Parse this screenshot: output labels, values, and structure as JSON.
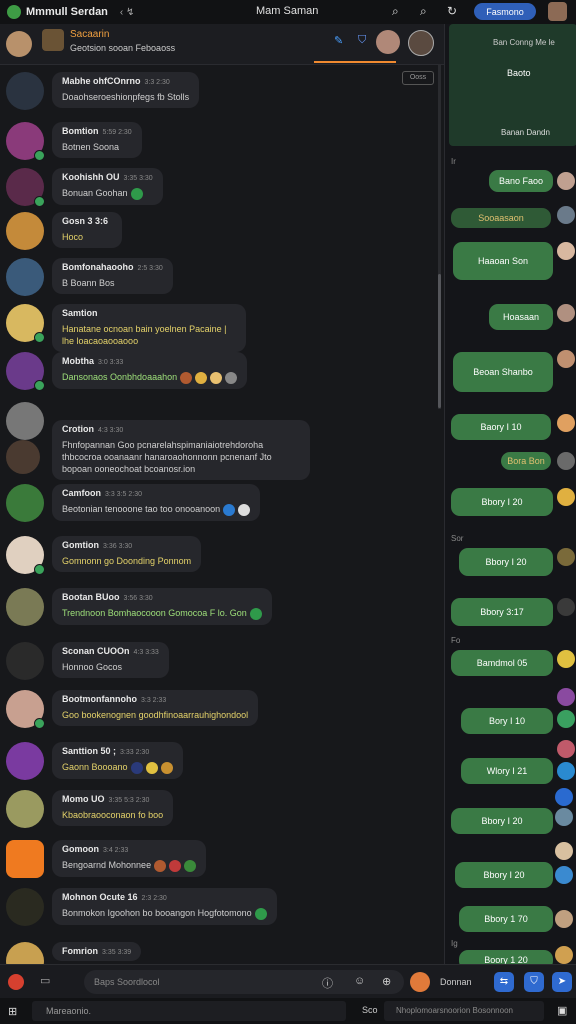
{
  "topbar": {
    "app_title": "Mmmull Serdan",
    "arrows": "‹ ↯",
    "center_title": "Mam Saman",
    "search_icon": "search-icon",
    "pill_label": "Fasmono"
  },
  "chat_header": {
    "name": "Sacaarin",
    "subtitle": "Geotsion sooan  Feboaoss"
  },
  "feed_badge": "Ooss",
  "messages": [
    {
      "author": "Mabhe ohfCOnrno",
      "time": "3:3 2:30",
      "text": "Doaohseroeshionpfegs  fb  Stolls",
      "text_color": "",
      "avatar_color": "#2a3340"
    },
    {
      "author": "Bomtion",
      "time": "5:59 2:30",
      "text": "Botnen    Soona",
      "text_color": "",
      "avatar_color": "#8a3a7a"
    },
    {
      "author": "Koohishh OU",
      "time": "3:35 3:30",
      "text": "Bonuan  Goohan",
      "text_color": "",
      "avatar_color": "#5a2a4a"
    },
    {
      "author": "Gosn 3 3:6",
      "time": "",
      "text": "Hoco",
      "text_color": "y",
      "avatar_color": "#c48a3a"
    },
    {
      "author": "Bomfonahaooho",
      "time": "2:5 3:30",
      "text": "B   Boann Bos",
      "text_color": "",
      "avatar_color": "#3a5a7a"
    },
    {
      "author": "Samtion",
      "time": "",
      "text": "Hanatane ocnoan bain yoelnen Pacaine | lhe loacaoaooaooo",
      "text_color": "y",
      "avatar_color": "#d8b860"
    },
    {
      "author": "Mobtha",
      "time": "3:0 3:33",
      "text": "Dansonaos  Oonbhdoaaahon",
      "text_color": "g",
      "avatar_color": "#6a3a8a"
    },
    {
      "author": "Crotion",
      "time": "4:3 3:30",
      "text": "Fhnfopannan  Goo pcnarelahspimaniaiotrehdoroha thbcocroa ooanaanr hanaroaohonnonn pcnenanf  Jto bopoan ooneochoat bcoanosr.ion",
      "text_color": "",
      "avatar_color": "#777777"
    },
    {
      "author": "Camfoon",
      "time": "3:3 3:5 2:30",
      "text": "Beotonian tenooone tao too onooanoon",
      "text_color": "",
      "avatar_color": "#3a7a3a"
    },
    {
      "author": "Gomtion",
      "time": "3:36 3:30",
      "text": "Gomnonn go Doonding Ponnom",
      "text_color": "y",
      "avatar_color": "#e0d0c0"
    },
    {
      "author": "Bootan BUoo",
      "time": "3:56 3:30",
      "text": "Trendnoon  Bomhaocooon   Gomocoa   F lo. Gon",
      "text_color": "g",
      "avatar_color": "#7a7a55"
    },
    {
      "author": "Sconan CUOOn",
      "time": "4:3 3:33",
      "text": "Honnoo    Gocos",
      "text_color": "",
      "avatar_color": "#2a2a2a"
    },
    {
      "author": "Bootmonfannoho",
      "time": "3:3 2:33",
      "text": "Goo  bookenognen goodhfinoaarrauhighondool",
      "text_color": "y",
      "avatar_color": "#c8a090"
    },
    {
      "author": "Santtion 50 ;",
      "time": "3:33 2:30",
      "text": "Gaonn    Boooano",
      "text_color": "y",
      "avatar_color": "#7a3aa0"
    },
    {
      "author": "Momo UO",
      "time": "3:35 5:3 2:30",
      "text": "Kbaobraooconaon  fo boo",
      "text_color": "y",
      "avatar_color": "#9a9a60"
    },
    {
      "author": "Gomoon",
      "time": "3:4 2:33",
      "text": "Bengoarnd Mohonnee",
      "text_color": "",
      "avatar_color": "#ef7a20"
    },
    {
      "author": "Mohnon Ocute 16",
      "time": "2:3 2:30",
      "text": "Bonmokon Igoohon bo booangon     Hogfotomono",
      "text_color": "",
      "avatar_color": "#2a2a20"
    },
    {
      "author": "Fomrion",
      "time": "3:35 3:39",
      "text": "",
      "text_color": "",
      "avatar_color": "#c8a050"
    }
  ],
  "right_panel": {
    "map_title": "Ban Conng  Me  le",
    "map_label": "Baoto",
    "map_footer": "Banan Dandn",
    "side_labels": [
      "Ir",
      "Sor",
      "Fo",
      "Ig"
    ],
    "bubbles": [
      "Bano Faoo",
      "Sooaasaon",
      "Haaoan Son",
      "Hoasaan",
      "Beoan Shanbo",
      "Baory I 10",
      "Bora Bon",
      "Bbory I 20",
      "Bbory I 20",
      "Bbory 3:17",
      "Bamdmol 05",
      "Bory I 10",
      "Wlory I 21",
      "Bbory I 20",
      "Bbory I 20",
      "Bbory 1 70",
      "Boory 1 20"
    ]
  },
  "composer": {
    "placeholder": "Baps Soordlocol",
    "name": "Donnan"
  },
  "footer": {
    "field_text": "Mareaonio.",
    "label": "Sco",
    "field2_text": "Nhoplomoarsnoorion  Bosonnoon"
  },
  "colors": {
    "accent_orange": "#f08a30",
    "bubble_green": "#3a7a45",
    "pill_blue": "#2f5fb8"
  }
}
